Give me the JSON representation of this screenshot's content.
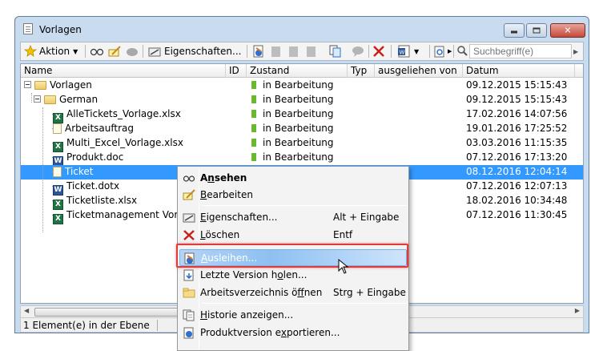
{
  "window": {
    "title": "Vorlagen"
  },
  "toolbar": {
    "action_label": "Aktion",
    "properties_label": "Eigenschaften...",
    "search_placeholder": "Suchbegriff(e)"
  },
  "columns": [
    "Name",
    "ID",
    "Zustand",
    "Typ",
    "ausgeliehen von",
    "Datum"
  ],
  "rows": [
    {
      "name": "Vorlagen",
      "icon": "folder",
      "level": 0,
      "zustand": "in Bearbeitung",
      "datum": "09.12.2015 15:15:43"
    },
    {
      "name": "German",
      "icon": "folder",
      "level": 1,
      "zustand": "in Bearbeitung",
      "datum": "09.12.2015 15:15:43"
    },
    {
      "name": "AlleTickets_Vorlage.xlsx",
      "icon": "excel",
      "level": 2,
      "zustand": "in Bearbeitung",
      "datum": "17.02.2016 14:07:56"
    },
    {
      "name": "Arbeitsauftrag",
      "icon": "document",
      "level": 2,
      "zustand": "in Bearbeitung",
      "datum": "19.01.2016 17:25:52"
    },
    {
      "name": "Multi_Excel_Vorlage.xlsx",
      "icon": "excel",
      "level": 2,
      "zustand": "in Bearbeitung",
      "datum": "03.03.2016 11:15:35"
    },
    {
      "name": "Produkt.doc",
      "icon": "word",
      "level": 2,
      "zustand": "in Bearbeitung",
      "datum": "07.12.2016 17:13:20"
    },
    {
      "name": "Ticket",
      "icon": "document",
      "level": 2,
      "zustand": "",
      "datum": "08.12.2016 12:04:14",
      "selected": true
    },
    {
      "name": "Ticket.dotx",
      "icon": "word",
      "level": 2,
      "zustand": "",
      "datum": "07.12.2016 12:07:13"
    },
    {
      "name": "Ticketliste.xlsx",
      "icon": "excel",
      "level": 2,
      "zustand": "",
      "datum": "18.02.2016 10:34:48"
    },
    {
      "name": "Ticketmanagement Vorlag",
      "icon": "excel",
      "level": 2,
      "zustand": "",
      "datum": "07.12.2016 11:30:45"
    }
  ],
  "context_menu": {
    "items": [
      {
        "pre": "A",
        "ul": "n",
        "post": "sehen",
        "shortcut": "",
        "icon": "glasses-icon",
        "bold": true
      },
      {
        "pre": "",
        "ul": "B",
        "post": "earbeiten",
        "shortcut": "",
        "icon": "edit-icon"
      },
      {
        "pre": "",
        "ul": "E",
        "post": "igenschaften...",
        "shortcut": "Alt + Eingabe",
        "icon": "properties-icon"
      },
      {
        "pre": "",
        "ul": "L",
        "post": "öschen",
        "shortcut": "Entf",
        "icon": "delete-icon"
      },
      {
        "pre": "",
        "ul": "A",
        "post": "usleihen...",
        "shortcut": "",
        "icon": "checkout-icon",
        "highlighted": true
      },
      {
        "pre": "Letzte Version h",
        "ul": "o",
        "post": "len...",
        "shortcut": "",
        "icon": "get-version-icon"
      },
      {
        "pre": "Arbeitsverzeichnis ö",
        "ul": "f",
        "post": "fnen",
        "shortcut": "Strg + Eingabe",
        "icon": "folder-icon"
      },
      {
        "pre": "",
        "ul": "H",
        "post": "istorie anzeigen...",
        "shortcut": "",
        "icon": "history-icon"
      },
      {
        "pre": "Produktversion e",
        "ul": "x",
        "post": "portieren...",
        "shortcut": "",
        "icon": "export-icon"
      }
    ]
  },
  "status": {
    "text": "1 Element(e) in der Ebene"
  },
  "colors": {
    "selection": "#3399ff",
    "highlight_border": "#e03a3a",
    "status_ok": "#6ab82e"
  }
}
